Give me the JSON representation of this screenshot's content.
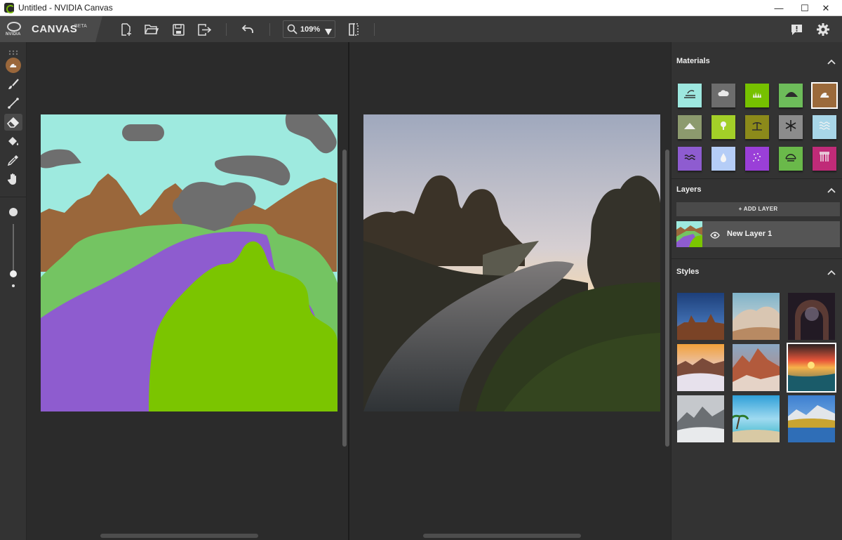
{
  "window": {
    "title": "Untitled - NVIDIA Canvas",
    "minimize": "—",
    "maximize": "☐",
    "close": "✕"
  },
  "brand": {
    "logo_text": "NVIDIA",
    "app_name": "CANVAS",
    "badge": "BETA"
  },
  "toolbar": {
    "icons": [
      "new-file-icon",
      "open-folder-icon",
      "save-icon",
      "export-icon",
      "undo-icon",
      "zoom-icon",
      "flip-view-icon",
      "feedback-icon",
      "gear-icon"
    ],
    "zoom_value": "109%"
  },
  "tools": {
    "items": [
      "material-brush",
      "brush",
      "line",
      "eraser",
      "fill",
      "eyedropper",
      "hand-pan"
    ],
    "active": "eraser",
    "brush_size_slider": 1.0
  },
  "panels": {
    "materials": {
      "label": "Materials",
      "selected_index": 4,
      "colors": [
        "#9de7df",
        "#6d6d6d",
        "#76c100",
        "#6dbc5a",
        "#9b6a3b",
        "#8c9a6e",
        "#a3cf28",
        "#8c8a1a",
        "#8c8c8c",
        "#a8d6e8",
        "#8e5cd0",
        "#b5cdf7",
        "#9a3fd8",
        "#6ab94a",
        "#c02b78"
      ],
      "icons": [
        "beach-icon",
        "cloud-icon",
        "grass-icon",
        "hill-icon",
        "rock-icon",
        "mountain-icon",
        "tree-icon",
        "palm-icon",
        "snow-icon",
        "sea-icon",
        "river-icon",
        "water-drop-icon",
        "fog-icon",
        "bush-icon",
        "bridge-icon"
      ]
    },
    "layers": {
      "label": "Layers",
      "add_button": "+ ADD LAYER",
      "items": [
        {
          "name": "New Layer 1",
          "visible": true
        }
      ]
    },
    "styles": {
      "label": "Styles",
      "selected_index": 5,
      "count": 9
    }
  },
  "colors": {
    "nvidia_green": "#76b900",
    "sky": "#9eeadf",
    "cloud": "#6e6e6e",
    "rock": "#9a673b",
    "grass": "#74c462",
    "river": "#8e5ccf",
    "foliage": "#7bc500"
  }
}
